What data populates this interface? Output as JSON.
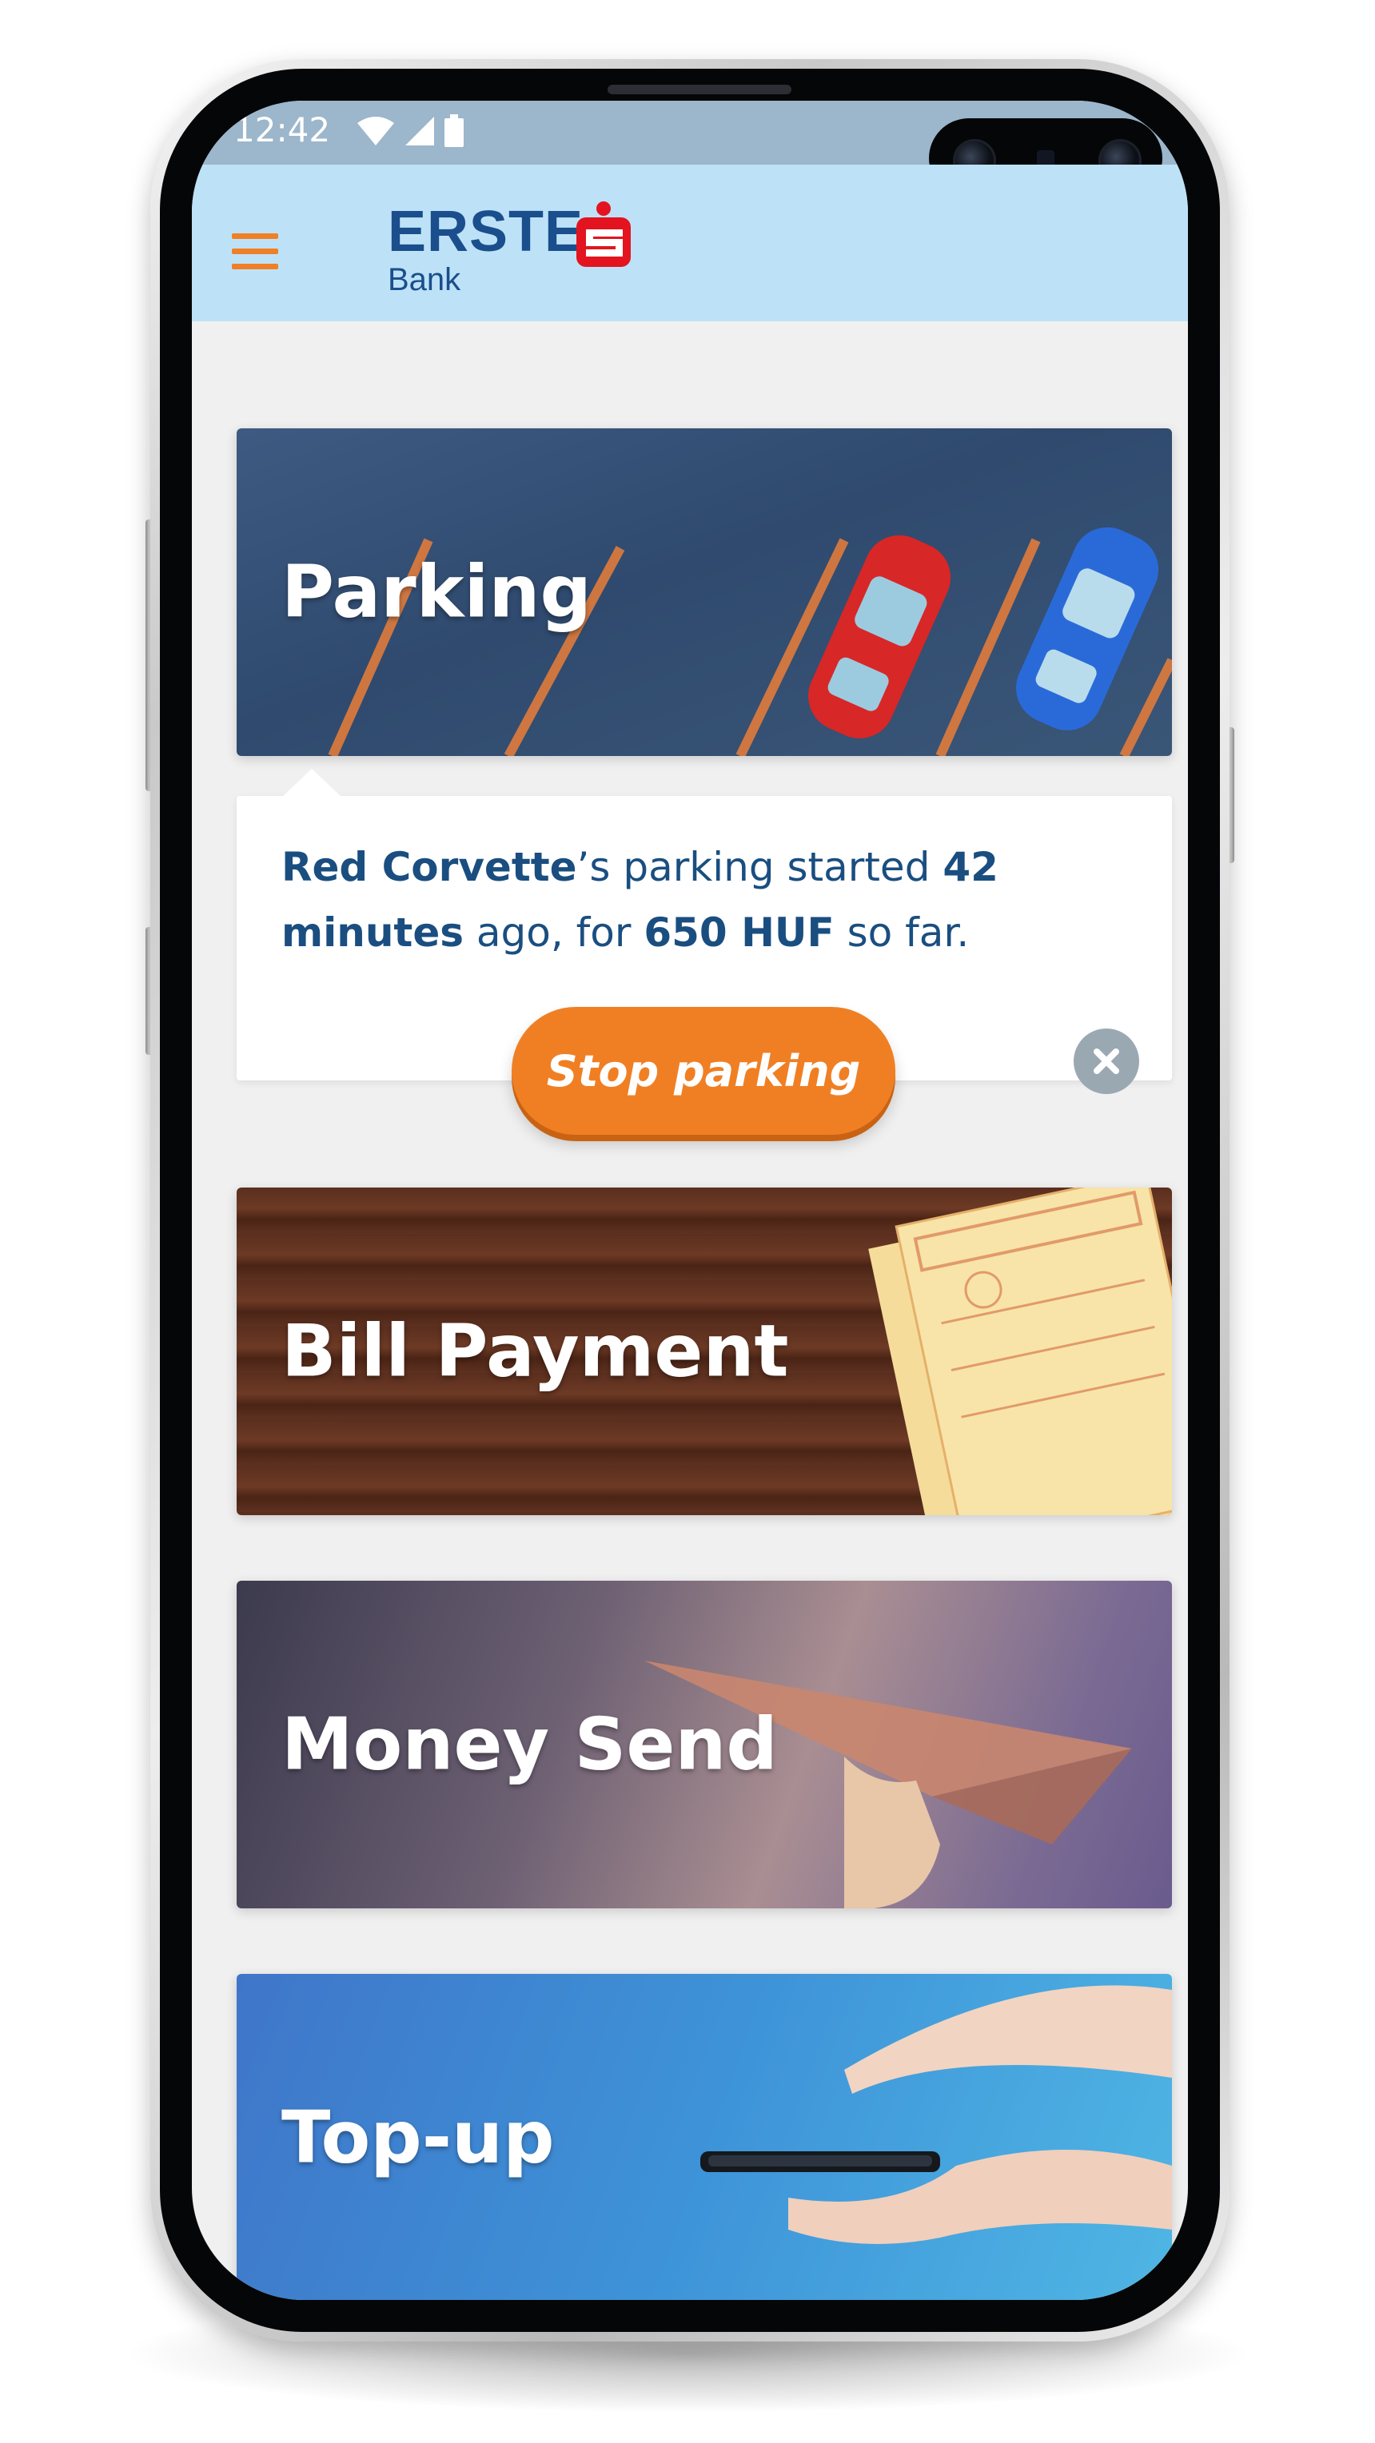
{
  "status_bar": {
    "time": "12:42",
    "icons": [
      "wifi-icon",
      "signal-icon",
      "battery-icon"
    ]
  },
  "header": {
    "menu_icon": "hamburger-menu-icon",
    "logo_primary": "ERSTE",
    "logo_secondary": "Bank"
  },
  "colors": {
    "accent_orange": "#f07f24",
    "brand_blue": "#1a4e8c",
    "logo_red": "#e3141f",
    "header_bg": "#bde2f7"
  },
  "cards": [
    {
      "id": "parking",
      "title": "Parking"
    },
    {
      "id": "bill-payment",
      "title": "Bill Payment"
    },
    {
      "id": "money-send",
      "title": "Money Send"
    },
    {
      "id": "top-up",
      "title": "Top-up"
    }
  ],
  "parking_status": {
    "car_name": "Red Corvette",
    "text_after_car": "’s parking started ",
    "duration": "42 minutes",
    "text_mid": " ago, for ",
    "amount": "650 HUF",
    "text_end": " so far.",
    "stop_button_label": "Stop parking",
    "close_icon": "close-icon"
  }
}
